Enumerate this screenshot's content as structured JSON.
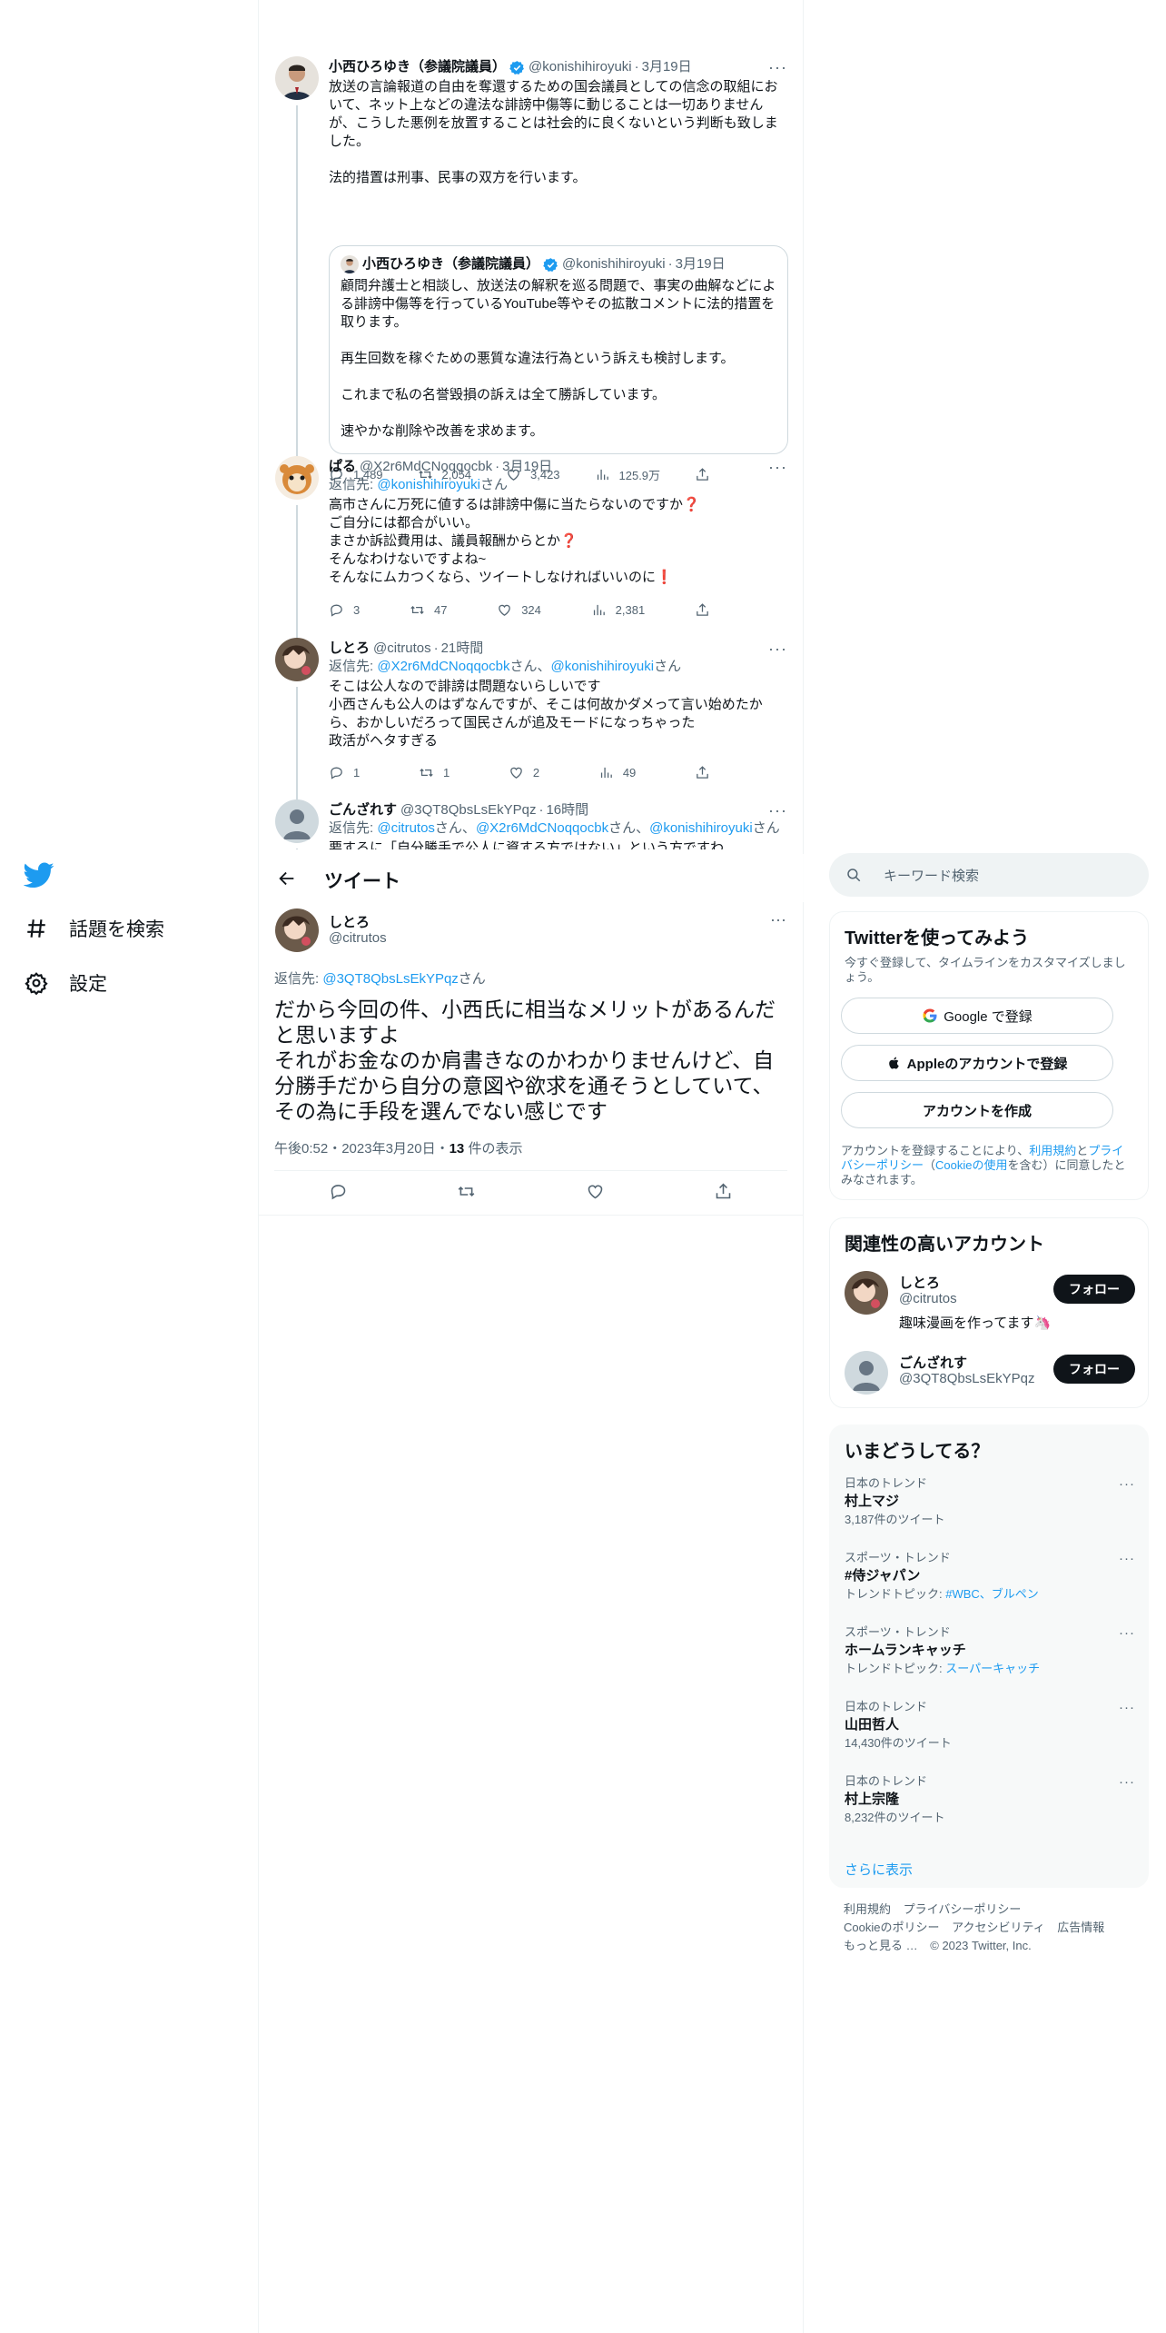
{
  "nav": {
    "items": [
      {
        "label": "話題を検索",
        "icon": "hashtag-icon"
      },
      {
        "label": "設定",
        "icon": "gear-icon"
      }
    ]
  },
  "thread": {
    "tweet1": {
      "name": "小西ひろゆき（参議院議員）",
      "handle": "@konishihiroyuki",
      "date": "3月19日",
      "text": "放送の言論報道の自由を奪還するための国会議員としての信念の取組において、ネット上などの違法な誹謗中傷等に動じることは一切ありませんが、こうした悪例を放置することは社会的に良くないという判断も致しました。\n\n法的措置は刑事、民事の双方を行います。",
      "quote": {
        "name": "小西ひろゆき（参議院議員）",
        "handle": "@konishihiroyuki",
        "date": "3月19日",
        "text": "顧問弁護士と相談し、放送法の解釈を巡る問題で、事実の曲解などによる誹謗中傷等を行っているYouTube等やその拡散コメントに法的措置を取ります。\n\n再生回数を稼ぐための悪質な違法行為という訴えも検討します。\n\nこれまで私の名誉毀損の訴えは全て勝訴しています。\n\n速やかな削除や改善を求めます。"
      },
      "replies": "1,489",
      "retweets": "2,054",
      "likes": "3,423",
      "views": "125.9万"
    },
    "tweet2": {
      "name": "ぱる",
      "handle": "@X2r6MdCNoqqocbk",
      "date": "3月19日",
      "reply_prefix": "返信先: ",
      "reply_link": "@konishihiroyuki",
      "reply_suffix": "さん",
      "text": "高市さんに万死に値するは誹謗中傷に当たらないのですか❓\nご自分には都合がいい。\nまさか訴訟費用は、議員報酬からとか❓\nそんなわけないですよね~\nそんなにムカつくなら、ツイートしなければいいのに❗",
      "replies": "3",
      "retweets": "47",
      "likes": "324",
      "views": "2,381"
    },
    "tweet3": {
      "name": "しとろ",
      "handle": "@citrutos",
      "date": "21時間",
      "reply_prefix": "返信先: ",
      "reply_link1": "@X2r6MdCNoqqocbk",
      "reply_mid": "さん、",
      "reply_link2": "@konishihiroyuki",
      "reply_suffix": "さん",
      "text": "そこは公人なので誹謗は問題ないらしいです\n小西さんも公人のはずなんですが、そこは何故かダメって言い始めたから、おかしいだろって国民さんが追及モードになっちゃった\n政活がヘタすぎる",
      "replies": "1",
      "retweets": "1",
      "likes": "2",
      "views": "49"
    },
    "tweet4": {
      "name": "ごんざれす",
      "handle": "@3QT8QbsLsEkYPqz",
      "date": "16時間",
      "reply_prefix": "返信先: ",
      "reply_link1": "@citrutos",
      "reply_mid1": "さん、",
      "reply_link2": "@X2r6MdCNoqqocbk",
      "reply_mid2": "さん、",
      "reply_link3": "@konishihiroyuki",
      "reply_suffix": "さん",
      "text": "要するに「自分勝手で公人に資する方ではない」という方ですわ"
    }
  },
  "header": {
    "title": "ツイート"
  },
  "focus": {
    "name": "しとろ",
    "handle": "@citrutos",
    "reply_prefix": "返信先: ",
    "reply_link": "@3QT8QbsLsEkYPqz",
    "reply_suffix": "さん",
    "text": "だから今回の件、小西氏に相当なメリットがあるんだと思いますよ\nそれがお金なのか肩書きなのかわかりませんけど、自分勝手だから自分の意図や欲求を通そうとしていて、その為に手段を選んでない感じです",
    "time": "午後0:52・2023年3月20日・",
    "views_count": "13",
    "views_label": " 件の表示"
  },
  "search": {
    "placeholder": "キーワード検索"
  },
  "signup": {
    "title": "Twitterを使ってみよう",
    "subtitle": "今すぐ登録して、タイムラインをカスタマイズしましょう。",
    "google_label": "Google で登録",
    "apple_label": "Appleのアカウントで登録",
    "create_label": "アカウントを作成",
    "legal_prefix": "アカウントを登録することにより、",
    "legal_terms": "利用規約",
    "legal_and": "と",
    "legal_privacy": "プライバシーポリシー",
    "legal_paren_open": "（",
    "legal_cookie": "Cookieの使用",
    "legal_suffix": "を含む）に同意したとみなされます。"
  },
  "related": {
    "title": "関連性の高いアカウント",
    "accounts": [
      {
        "name": "しとろ",
        "handle": "@citrutos",
        "bio": "趣味漫画を作ってます🦄",
        "follow": "フォロー"
      },
      {
        "name": "ごんざれす",
        "handle": "@3QT8QbsLsEkYPqz",
        "bio": "",
        "follow": "フォロー"
      }
    ]
  },
  "trends": {
    "title": "いまどうしてる？",
    "items": [
      {
        "category": "日本のトレンド",
        "name": "村上マジ",
        "meta": "3,187件のツイート"
      },
      {
        "category": "スポーツ・トレンド",
        "name": "#侍ジャパン",
        "meta_prefix": "トレンドトピック: ",
        "meta_link": "#WBC、ブルペン"
      },
      {
        "category": "スポーツ・トレンド",
        "name": "ホームランキャッチ",
        "meta_prefix": "トレンドトピック: ",
        "meta_link": "スーパーキャッチ"
      },
      {
        "category": "日本のトレンド",
        "name": "山田哲人",
        "meta": "14,430件のツイート"
      },
      {
        "category": "日本のトレンド",
        "name": "村上宗隆",
        "meta": "8,232件のツイート"
      }
    ],
    "show_more": "さらに表示"
  },
  "footer": {
    "terms": "利用規約",
    "privacy": "プライバシーポリシー",
    "cookie": "Cookieのポリシー",
    "accessibility": "アクセシビリティ",
    "ads": "広告情報",
    "more": "もっと見る …",
    "copyright": "© 2023 Twitter, Inc."
  },
  "colors": {
    "accent": "#1d9bf0",
    "text": "#0f1419",
    "muted": "#536471"
  }
}
